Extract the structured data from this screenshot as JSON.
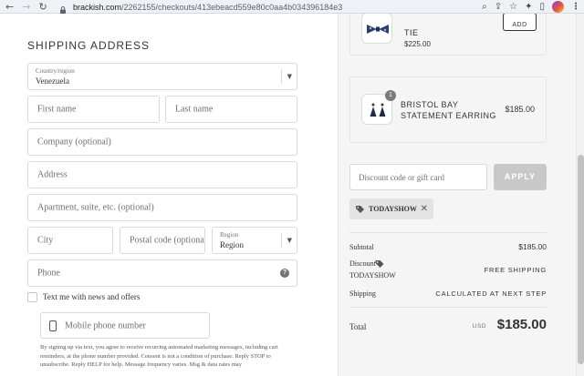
{
  "browser": {
    "url_host": "brackish.com",
    "url_path": "/2262155/checkouts/413ebeacd559e80c0aa4b034396184e3"
  },
  "shipping": {
    "title": "SHIPPING ADDRESS",
    "country_label": "Country/region",
    "country_value": "Venezuela",
    "first_name_placeholder": "First name",
    "last_name_placeholder": "Last name",
    "company_placeholder": "Company (optional)",
    "address_placeholder": "Address",
    "apartment_placeholder": "Apartment, suite, etc. (optional)",
    "city_placeholder": "City",
    "postal_placeholder": "Postal code (optional)",
    "region_label": "Region",
    "region_value": "Region",
    "phone_placeholder": "Phone",
    "news_checkbox_label": "Text me with news and offers",
    "mobile_placeholder": "Mobile phone number",
    "consent_text": "By signing up via text, you agree to receive recurring automated marketing messages, including cart reminders, at the phone number provided. Consent is not a condition of purchase. Reply STOP to unsubscribe. Reply HELP for help. Message frequency varies. Msg & data rates may"
  },
  "cart": {
    "items": [
      {
        "name_partial": "TIE",
        "price": "$225.00",
        "add_label": "ADD"
      },
      {
        "name_line1": "BRISTOL BAY",
        "name_line2": "STATEMENT EARRING",
        "price": "$185.00",
        "quantity": "1"
      }
    ]
  },
  "discount": {
    "placeholder": "Discount code or gift card",
    "apply_label": "APPLY",
    "applied_code": "TODAYSHOW"
  },
  "summary": {
    "subtotal_label": "Subtotal",
    "subtotal_value": "$185.00",
    "discount_label": "Discount",
    "discount_code": "TODAYSHOW",
    "discount_value": "FREE SHIPPING",
    "shipping_label": "Shipping",
    "shipping_value": "CALCULATED AT NEXT STEP",
    "total_label": "Total",
    "currency": "USD",
    "total_value": "$185.00"
  }
}
